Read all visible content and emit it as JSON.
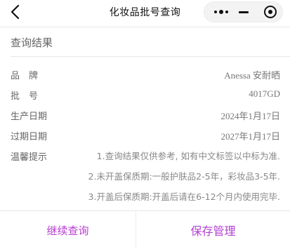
{
  "nav": {
    "title": "化妆品批号查询",
    "back_icon": "chevron-left-icon",
    "more_icon": "more-dots-icon",
    "minimize_icon": "minimize-icon",
    "close_icon": "target-close-icon"
  },
  "section": {
    "title": "查询结果"
  },
  "rows": [
    {
      "label": "品　牌",
      "value": "Anessa 安耐晒"
    },
    {
      "label": "批　号",
      "value": "4017GD"
    },
    {
      "label": "生产日期",
      "value": "2024年1月17日"
    },
    {
      "label": "过期日期",
      "value": "2027年1月17日"
    }
  ],
  "tips": {
    "label": "温馨提示",
    "lines": [
      "1.查询结果仅供参考, 如有中文标签以中标为准.",
      "2.未开盖保质期:一般护肤品2-5年，彩妆品3-5年.",
      "3.开盖后保质期:开盖后请在6-12个月内使用完毕."
    ]
  },
  "footer": {
    "continue_label": "继续查询",
    "save_label": "保存管理"
  },
  "colors": {
    "accent": "#b73bd1",
    "text_muted": "#777777",
    "divider": "#e6e6e6"
  }
}
